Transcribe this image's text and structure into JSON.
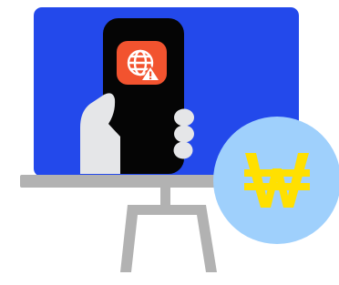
{
  "illustration": {
    "subject": "presentation-board-with-phone-network-warning-and-won-coin",
    "colors": {
      "board": "#2349EB",
      "stand": "#B2B2B2",
      "phone": "#050505",
      "app_icon": "#F2532F",
      "hand": "#E5E6E8",
      "coin": "#9FD0FC",
      "coin_symbol": "#FFE000"
    },
    "icons": [
      "globe-icon",
      "warning-icon",
      "hand-icon",
      "won-currency-icon"
    ]
  }
}
